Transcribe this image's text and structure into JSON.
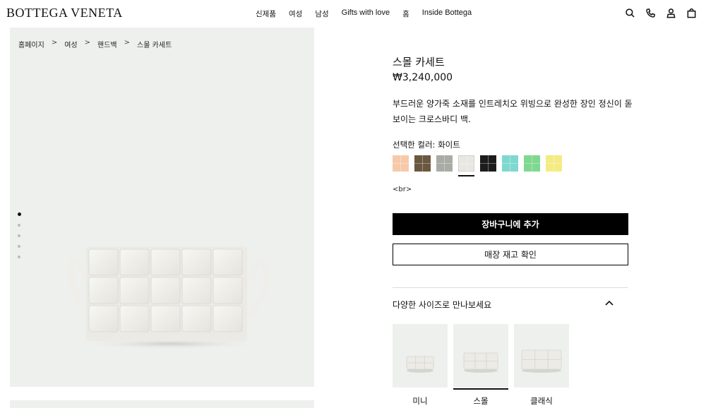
{
  "brand": {
    "logo": "BOTTEGA VENETA"
  },
  "nav": [
    {
      "label": "신제품",
      "latin": false
    },
    {
      "label": "여성",
      "latin": false
    },
    {
      "label": "남성",
      "latin": false
    },
    {
      "label": "Gifts with love",
      "latin": true
    },
    {
      "label": "홈",
      "latin": false
    },
    {
      "label": "Inside Bottega",
      "latin": true
    }
  ],
  "header_icons": [
    "search-icon",
    "phone-icon",
    "account-icon",
    "shopping-bag-icon"
  ],
  "breadcrumb": [
    "홈페이지",
    "여성",
    "핸드백",
    "스몰 카세트"
  ],
  "breadcrumb_sep": ">",
  "gallery": {
    "dot_count": 5,
    "active_index": 0
  },
  "product": {
    "title": "스몰 카세트",
    "price": "₩3,240,000",
    "description": "부드러운 양가죽 소재를 인트레치오 위빙으로 완성한 장인 정신이 돋보이는 크로스바디 백.",
    "color_label": "선택한 컬러: 화이트",
    "br_text": "<br>",
    "add_to_cart": "장바구니에 추가",
    "check_stock": "매장 재고 확인"
  },
  "colors": [
    {
      "name": "peach",
      "hex": "#f6c9a9"
    },
    {
      "name": "brown",
      "hex": "#6b5840"
    },
    {
      "name": "grey",
      "hex": "#a9aca5"
    },
    {
      "name": "white",
      "hex": "#e9e7e1",
      "selected": true
    },
    {
      "name": "black",
      "hex": "#1c1c1c"
    },
    {
      "name": "aqua",
      "hex": "#7ed8d0"
    },
    {
      "name": "green",
      "hex": "#7fd88f"
    },
    {
      "name": "yellow",
      "hex": "#f4ec82"
    }
  ],
  "sizes": {
    "title": "다양한 사이즈로 만나보세요",
    "items": [
      {
        "label": "미니",
        "selected": false
      },
      {
        "label": "스몰",
        "selected": true
      },
      {
        "label": "클래식",
        "selected": false
      }
    ]
  }
}
